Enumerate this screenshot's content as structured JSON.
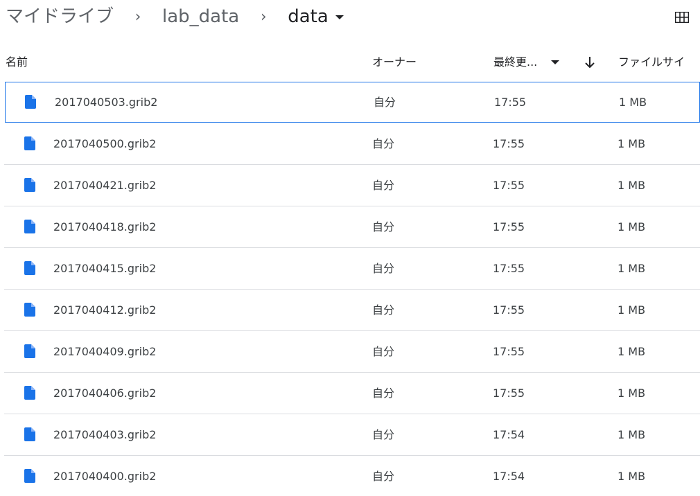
{
  "breadcrumb": {
    "root": "マイドライブ",
    "parent": "lab_data",
    "current": "data",
    "separator": "›"
  },
  "toolbar": {
    "layout_icon": "grid-view-icon"
  },
  "columns": {
    "name": "名前",
    "owner": "オーナー",
    "modified": "最終更...",
    "size": "ファイルサイ"
  },
  "colors": {
    "file_icon": "#1a73e8",
    "selected_border": "#1a73e8",
    "row_divider": "#dadce0"
  },
  "files": [
    {
      "name": "2017040503.grib2",
      "owner": "自分",
      "modified": "17:55",
      "size": "1 MB",
      "selected": true
    },
    {
      "name": "2017040500.grib2",
      "owner": "自分",
      "modified": "17:55",
      "size": "1 MB"
    },
    {
      "name": "2017040421.grib2",
      "owner": "自分",
      "modified": "17:55",
      "size": "1 MB"
    },
    {
      "name": "2017040418.grib2",
      "owner": "自分",
      "modified": "17:55",
      "size": "1 MB"
    },
    {
      "name": "2017040415.grib2",
      "owner": "自分",
      "modified": "17:55",
      "size": "1 MB"
    },
    {
      "name": "2017040412.grib2",
      "owner": "自分",
      "modified": "17:55",
      "size": "1 MB"
    },
    {
      "name": "2017040409.grib2",
      "owner": "自分",
      "modified": "17:55",
      "size": "1 MB"
    },
    {
      "name": "2017040406.grib2",
      "owner": "自分",
      "modified": "17:55",
      "size": "1 MB"
    },
    {
      "name": "2017040403.grib2",
      "owner": "自分",
      "modified": "17:54",
      "size": "1 MB"
    },
    {
      "name": "2017040400.grib2",
      "owner": "自分",
      "modified": "17:54",
      "size": "1 MB"
    }
  ]
}
